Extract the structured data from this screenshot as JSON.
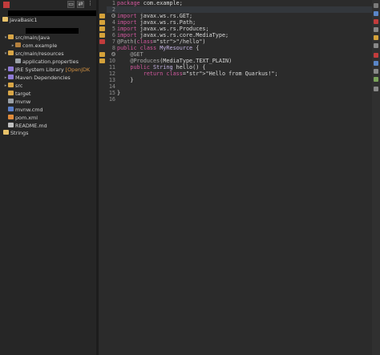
{
  "explorer": {
    "toolbar": {
      "collapse_label": "▭",
      "link_label": "⇄",
      "menu_label": "⋮"
    },
    "project": "JavaBasic1",
    "items": [
      {
        "label": "src/main/java",
        "twisty": "▾",
        "icon": "folder-icon"
      },
      {
        "label": "com.example",
        "twisty": "▸",
        "icon": "package-icon"
      },
      {
        "label": "src/main/resources",
        "twisty": "▾",
        "icon": "folder-icon"
      },
      {
        "label": "application.properties",
        "twisty": "",
        "icon": "properties-file-icon"
      },
      {
        "label": "JRE System Library",
        "qualifier": "[OpenJDK",
        "twisty": "▸",
        "icon": "library-icon"
      },
      {
        "label": "Maven Dependencies",
        "twisty": "▸",
        "icon": "library-icon"
      },
      {
        "label": "src",
        "twisty": "▸",
        "icon": "folder-icon"
      },
      {
        "label": "target",
        "twisty": "",
        "icon": "folder-icon"
      },
      {
        "label": "mvnw",
        "twisty": "",
        "icon": "file-icon"
      },
      {
        "label": "mvnw.cmd",
        "twisty": "",
        "icon": "cmd-file-icon"
      },
      {
        "label": "pom.xml",
        "twisty": "",
        "icon": "xml-file-icon"
      },
      {
        "label": "README.md",
        "twisty": "",
        "icon": "text-file-icon"
      }
    ],
    "strings_project": "Strings"
  },
  "editor": {
    "line_numbers": [
      "1",
      "2",
      "3",
      "4",
      "5",
      "6",
      "7",
      "8",
      "9",
      "10",
      "11",
      "12",
      "13",
      "14",
      "15",
      "16"
    ],
    "lines": [
      "package com.example;",
      "",
      "import javax.ws.rs.GET;",
      "import javax.ws.rs.Path;",
      "import javax.ws.rs.Produces;",
      "import javax.ws.rs.core.MediaType;",
      "@Path(\"/hello\")",
      "public class MyResource {",
      "    @GET",
      "    @Produces(MediaType.TEXT_PLAIN)",
      "    public String hello() {",
      "        return \"Hello from Quarkus!\";",
      "    }",
      "",
      "}",
      ""
    ]
  },
  "colors": {
    "editor_bg": "#2b2b2b",
    "keyword": "#d1589e",
    "string": "#3fa9e8",
    "warning_marker": "#d5a23a",
    "error_marker": "#c23c3c"
  }
}
